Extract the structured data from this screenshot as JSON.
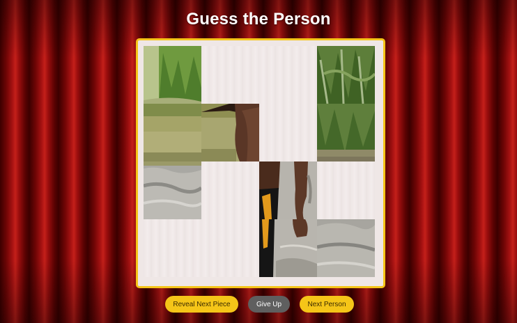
{
  "title": "Guess the Person",
  "buttons": {
    "reveal": "Reveal Next Piece",
    "give_up": "Give Up",
    "next": "Next Person"
  },
  "puzzle": {
    "rows": 4,
    "cols": 4,
    "revealed": [
      [
        true,
        false,
        false,
        true
      ],
      [
        true,
        true,
        false,
        true
      ],
      [
        true,
        false,
        true,
        false
      ],
      [
        false,
        false,
        true,
        true
      ]
    ]
  },
  "colors": {
    "accent": "#f5c518",
    "give_up_button": "#5f5f5f",
    "curtain": "#8b0a0a"
  }
}
